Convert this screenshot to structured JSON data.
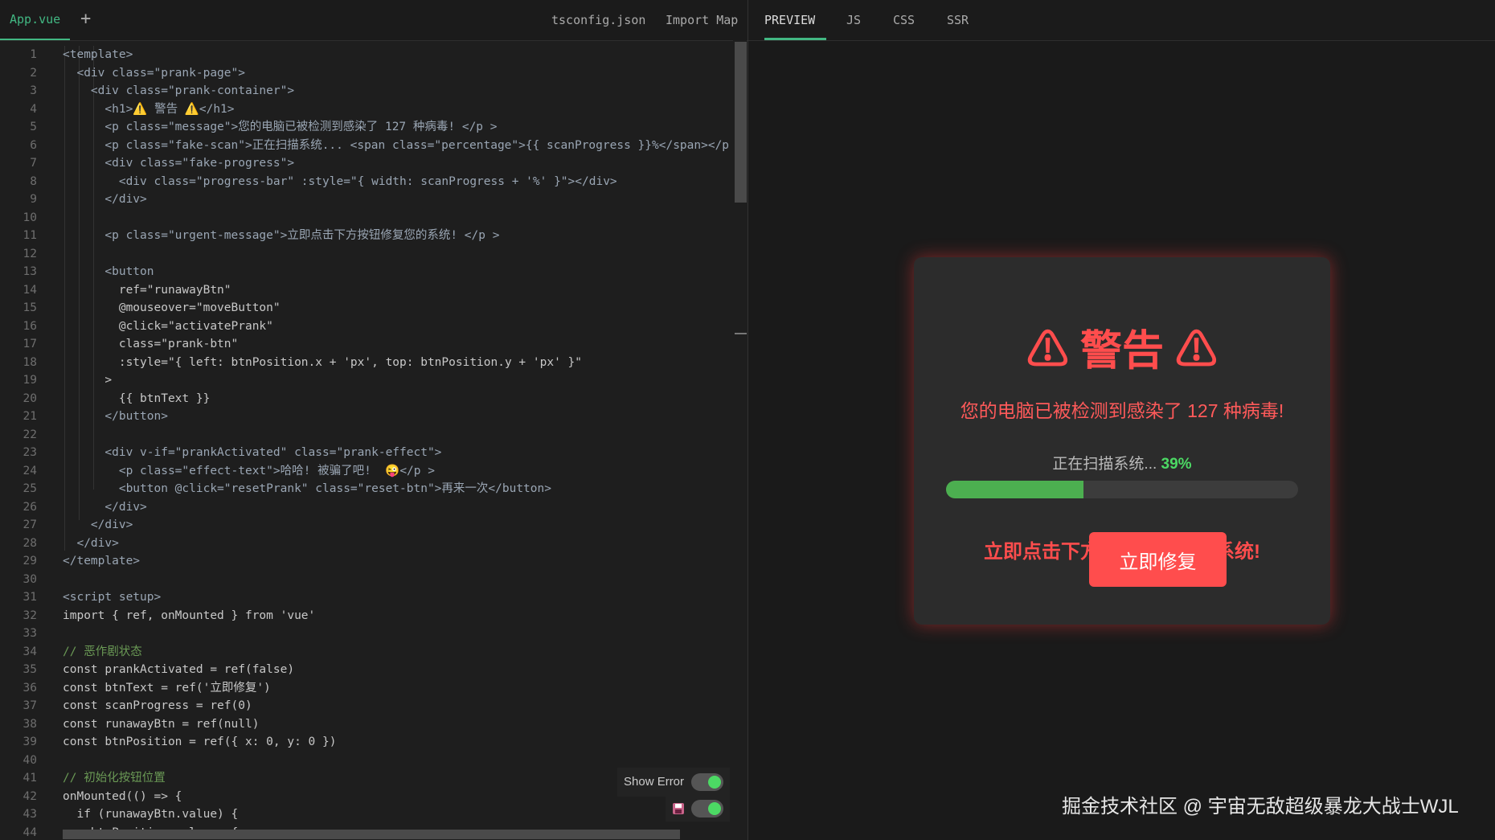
{
  "editor": {
    "tabs": [
      {
        "label": "App.vue"
      }
    ],
    "add_tab": "+",
    "right_tabs": [
      {
        "label": "tsconfig.json"
      },
      {
        "label": "Import Map"
      }
    ],
    "code_lines": [
      "<template>",
      "  <div class=\"prank-page\">",
      "    <div class=\"prank-container\">",
      "      <h1>⚠️ 警告 ⚠️</h1>",
      "      <p class=\"message\">您的电脑已被检测到感染了 127 种病毒! </p >",
      "      <p class=\"fake-scan\">正在扫描系统... <span class=\"percentage\">{{ scanProgress }}%</span></p",
      "      <div class=\"fake-progress\">",
      "        <div class=\"progress-bar\" :style=\"{ width: scanProgress + '%' }\"></div>",
      "      </div>",
      "",
      "      <p class=\"urgent-message\">立即点击下方按钮修复您的系统! </p >",
      "",
      "      <button",
      "        ref=\"runawayBtn\"",
      "        @mouseover=\"moveButton\"",
      "        @click=\"activatePrank\"",
      "        class=\"prank-btn\"",
      "        :style=\"{ left: btnPosition.x + 'px', top: btnPosition.y + 'px' }\"",
      "      >",
      "        {{ btnText }}",
      "      </button>",
      "",
      "      <div v-if=\"prankActivated\" class=\"prank-effect\">",
      "        <p class=\"effect-text\">哈哈! 被骗了吧!  😜</p >",
      "        <button @click=\"resetPrank\" class=\"reset-btn\">再来一次</button>",
      "      </div>",
      "    </div>",
      "  </div>",
      "</template>",
      "",
      "<script setup>",
      "import { ref, onMounted } from 'vue'",
      "",
      "// 恶作剧状态",
      "const prankActivated = ref(false)",
      "const btnText = ref('立即修复')",
      "const scanProgress = ref(0)",
      "const runawayBtn = ref(null)",
      "const btnPosition = ref({ x: 0, y: 0 })",
      "",
      "// 初始化按钮位置",
      "onMounted(() => {",
      "  if (runawayBtn.value) {",
      "    btnPosition.value = {"
    ],
    "show_error_label": "Show Error"
  },
  "preview": {
    "tabs": [
      {
        "label": "PREVIEW"
      },
      {
        "label": "JS"
      },
      {
        "label": "CSS"
      },
      {
        "label": "SSR"
      }
    ],
    "title": "⚠ 警告 ⚠",
    "message": "您的电脑已被检测到感染了 127 种病毒!",
    "scan_text": "正在扫描系统... ",
    "scan_percent": "39%",
    "progress": 0.39,
    "urgent_text": "立即点击下方按钮修复您的系统!",
    "button_label": "立即修复",
    "watermark": "掘金技术社区 @ 宇宙无敌超级暴龙大战士WJL"
  },
  "colors": {
    "accent": "#42b883",
    "danger": "#ff4d4d",
    "progress": "#4caf50",
    "toggle_on": "#4cd964"
  },
  "icons": {
    "save": "save-icon",
    "warning": "warning-icon"
  }
}
